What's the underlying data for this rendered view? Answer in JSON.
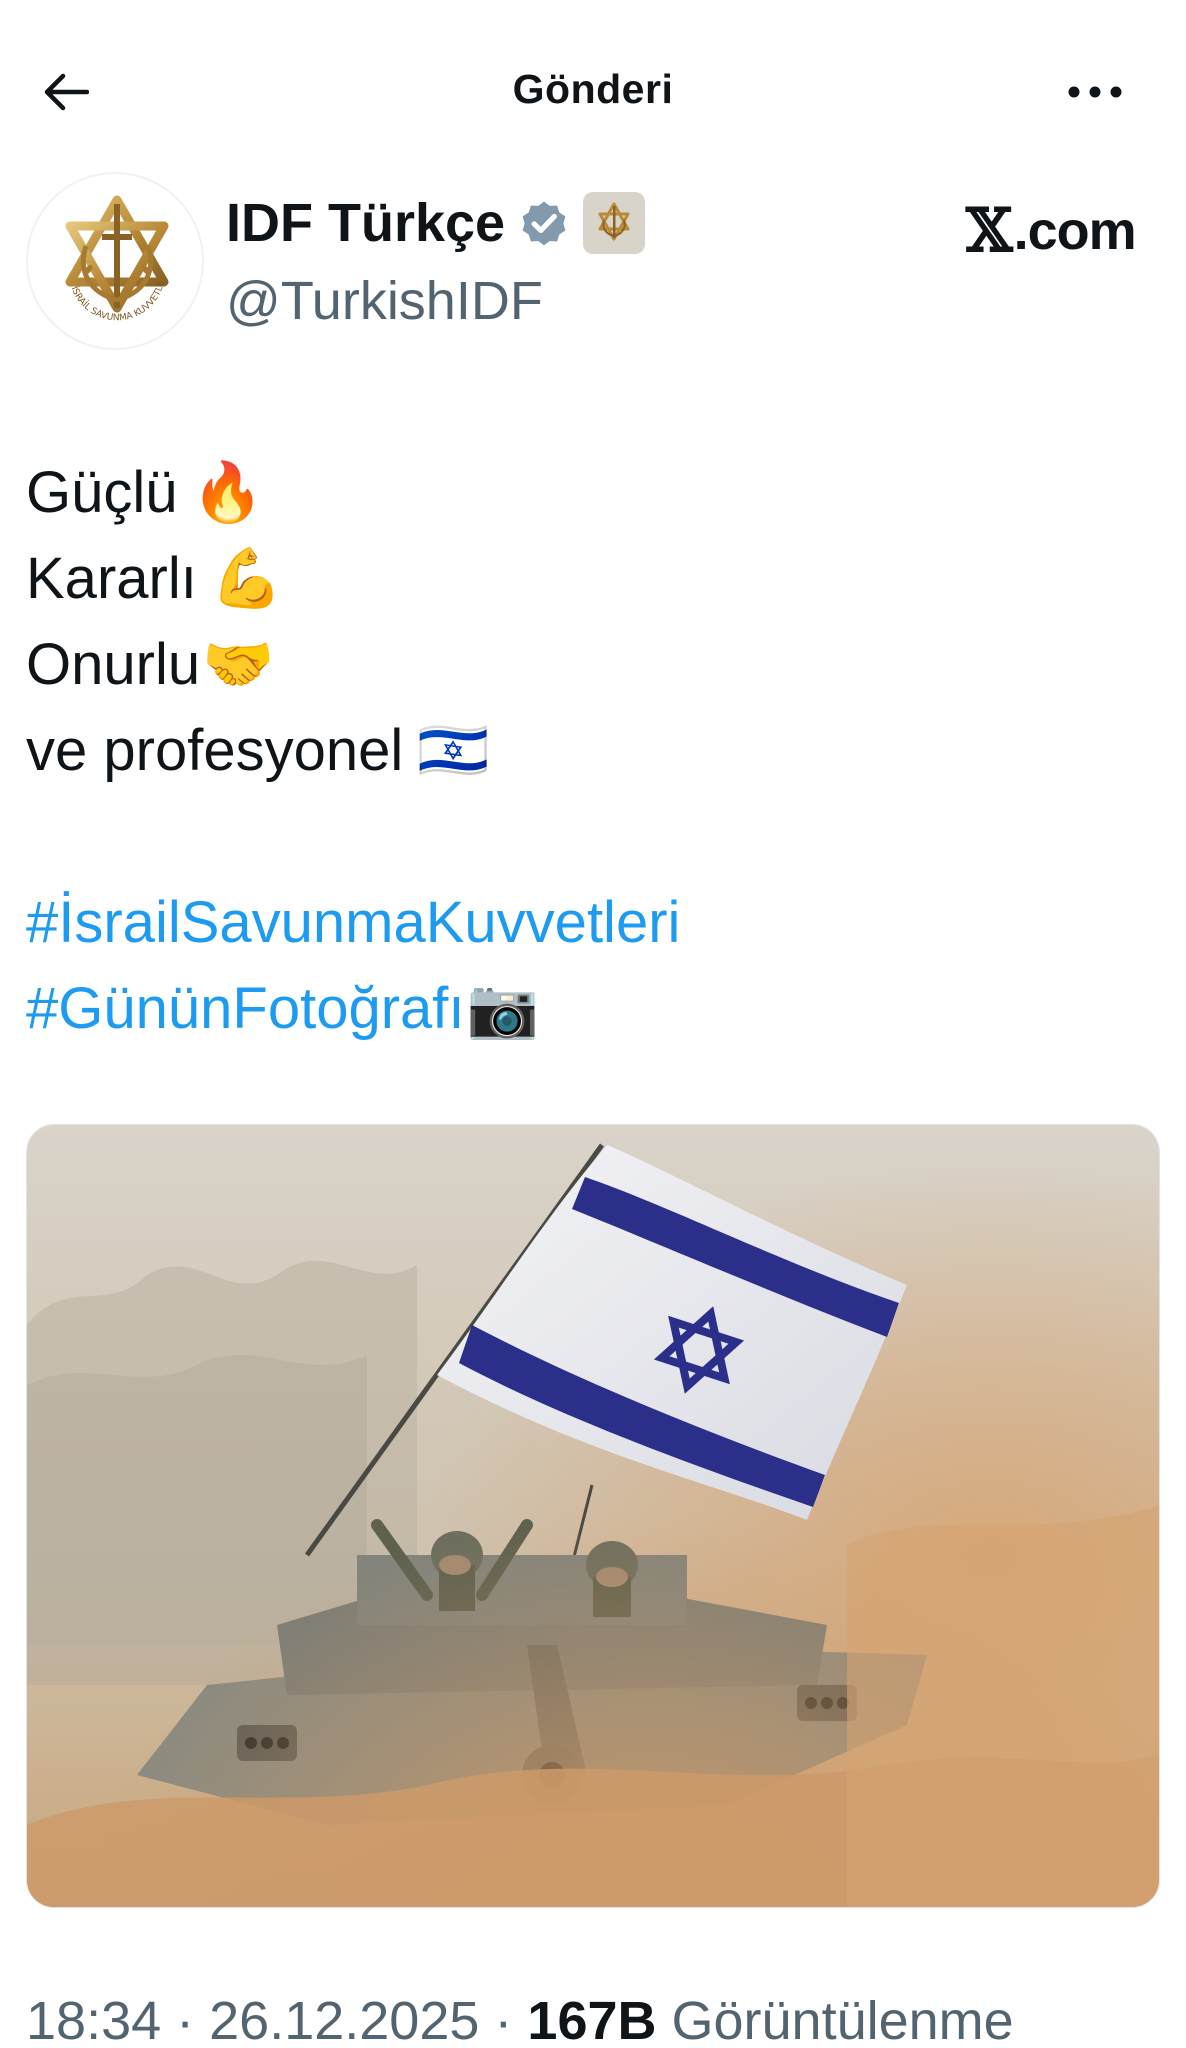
{
  "header": {
    "title": "Gönderi",
    "back_icon": "arrow-left-icon",
    "more_icon": "more-horizontal-icon"
  },
  "author": {
    "name": "IDF Türkçe",
    "handle": "@TurkishIDF",
    "verified_color": "#829aab",
    "avatar_icon": "idf-emblem-logo",
    "avatar_seal_text": "İSRAİL SAVUNMA KUVVETLERİ"
  },
  "brand": {
    "x_mark": "𝕏",
    "suffix": ".com"
  },
  "post": {
    "lines": [
      {
        "text": "Güçlü",
        "emoji": "🔥"
      },
      {
        "text": "Kararlı",
        "emoji": "💪"
      },
      {
        "text": "Onurlu",
        "emoji": "🤝"
      },
      {
        "text": "ve profesyonel",
        "emoji": "🇮🇱"
      }
    ],
    "hashtags": [
      {
        "text": "#İsrailSavunmaKuvvetleri",
        "emoji": ""
      },
      {
        "text": "#GününFotoğrafı",
        "emoji": "📷"
      }
    ]
  },
  "media": {
    "icon": "tank-with-flag-photo"
  },
  "meta": {
    "time": "18:34",
    "sep1": " · ",
    "date": "26.12.2025",
    "sep2": " · ",
    "views_count": "167B",
    "views_label": " Görüntülenme"
  },
  "colors": {
    "link": "#1d9bf0",
    "secondary_text": "#536471",
    "primary_text": "#0f1419",
    "flag_blue": "#2b2f8a"
  }
}
